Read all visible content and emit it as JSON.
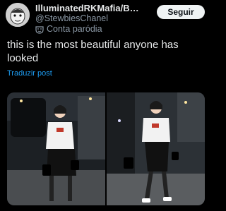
{
  "author": {
    "display_name": "IlluminatedRKMafia/Ba...",
    "handle": "@StewbiesChanel",
    "label": "Conta paródia"
  },
  "follow_label": "Seguir",
  "tweet": {
    "text": "this is the most beautiful anyone has looked",
    "translate_label": "Traduzir post"
  },
  "icons": {
    "avatar": "cartoon-avatar",
    "parody": "mask-icon"
  },
  "media": {
    "count": 2
  },
  "colors": {
    "background": "#000000",
    "text": "#e7e9ea",
    "secondary_text": "#8b98a5",
    "link": "#1d9bf0",
    "button_bg": "#eff3f4",
    "button_text": "#0f1419"
  }
}
